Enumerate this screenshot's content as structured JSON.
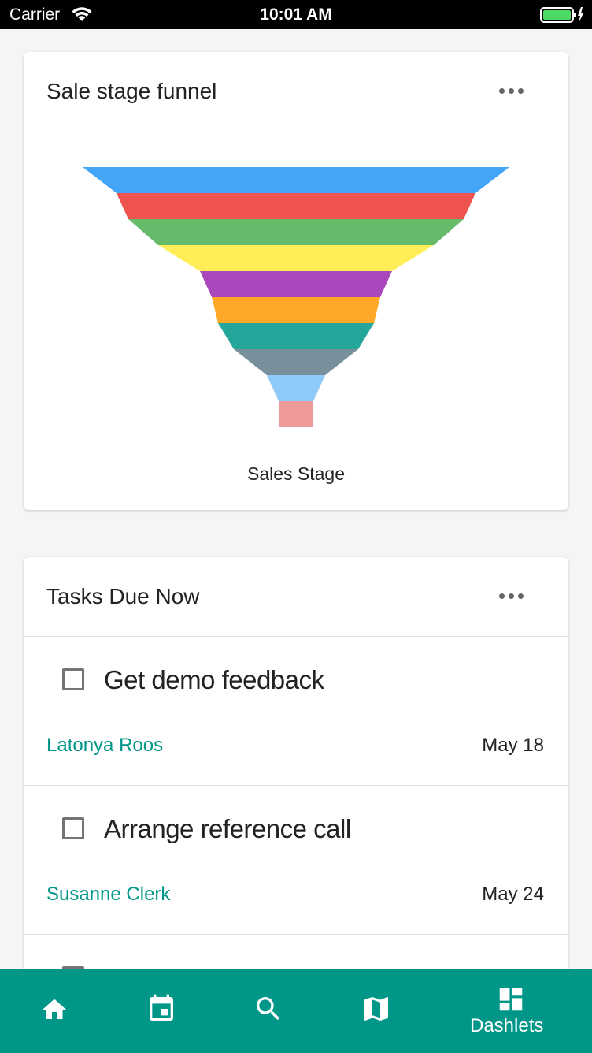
{
  "status_bar": {
    "carrier": "Carrier",
    "time": "10:01 AM"
  },
  "funnel_card": {
    "title": "Sale stage funnel",
    "more_icon": "more-horizontal-icon"
  },
  "chart_data": {
    "type": "funnel",
    "xlabel": "Sales Stage",
    "stages": [
      {
        "color": "#42a5f5"
      },
      {
        "color": "#ef5350"
      },
      {
        "color": "#66bb6a"
      },
      {
        "color": "#ffee58"
      },
      {
        "color": "#ab47bc"
      },
      {
        "color": "#ffa726"
      },
      {
        "color": "#26a69a"
      },
      {
        "color": "#78909c"
      },
      {
        "color": "#90caf9"
      },
      {
        "color": "#ef9a9a"
      }
    ]
  },
  "tasks_card": {
    "title": "Tasks Due Now",
    "more_icon": "more-horizontal-icon",
    "tasks": [
      {
        "name": "Get demo feedback",
        "assignee": "Latonya Roos",
        "date": "May 18"
      },
      {
        "name": "Arrange reference call",
        "assignee": "Susanne Clerk",
        "date": "May 24"
      },
      {
        "name": "",
        "assignee": "",
        "date": ""
      }
    ]
  },
  "bottom_nav": {
    "items": [
      {
        "icon": "home-icon",
        "label": ""
      },
      {
        "icon": "calendar-icon",
        "label": ""
      },
      {
        "icon": "search-icon",
        "label": ""
      },
      {
        "icon": "map-icon",
        "label": ""
      },
      {
        "icon": "dashboard-icon",
        "label": "Dashlets"
      }
    ]
  },
  "colors": {
    "accent": "#009688"
  }
}
